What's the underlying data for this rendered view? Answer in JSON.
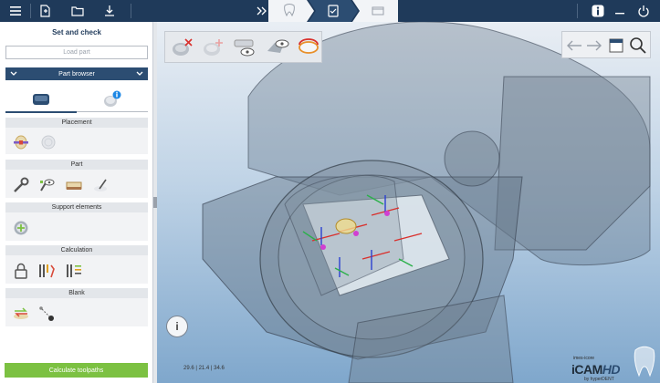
{
  "topbar": {
    "icons": [
      "menu-icon",
      "new-document-icon",
      "open-folder-icon",
      "download-icon"
    ],
    "right_icons": [
      "info-icon",
      "minimize-icon",
      "power-icon"
    ]
  },
  "sidebar": {
    "title": "Set and check",
    "load_part_label": "Load part",
    "dropdown_label": "Part browser",
    "sections": [
      {
        "heading": "Placement"
      },
      {
        "heading": "Part"
      },
      {
        "heading": "Support elements"
      },
      {
        "heading": "Calculation"
      },
      {
        "heading": "Blank"
      }
    ],
    "calculate_label": "Calculate toolpaths"
  },
  "viewport": {
    "info_glyph": "i",
    "coordinates": "29.6 | 21.4 | 34.6",
    "logo_small": "imes-icore",
    "logo_main_a": "iCAM",
    "logo_main_b": "HD",
    "logo_by": "by hyperDENT"
  },
  "colors": {
    "topbar": "#1f3a5a",
    "accent": "#2c4d72",
    "calc_button": "#7cc142",
    "viewport_top": "#e9eef4",
    "viewport_bottom": "#7fa7cc"
  }
}
